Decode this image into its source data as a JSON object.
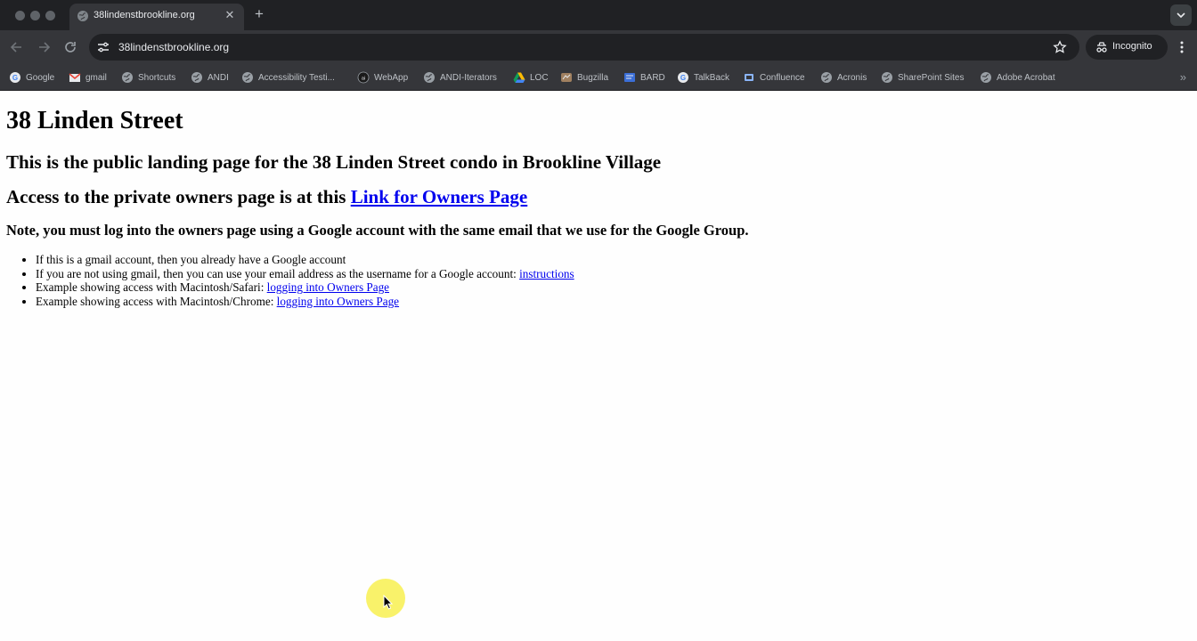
{
  "browser": {
    "tab": {
      "title": "38lindenstbrookline.org",
      "close_glyph": "✕"
    },
    "new_tab_glyph": "+",
    "url": "38lindenstbrookline.org",
    "incognito_label": "Incognito",
    "bookmarks": [
      {
        "label": "Google",
        "icon": "google-icon"
      },
      {
        "label": "gmail",
        "icon": "gmail-icon"
      },
      {
        "label": "Shortcuts",
        "icon": "globe-icon"
      },
      {
        "label": "ANDI",
        "icon": "globe-icon"
      },
      {
        "label": "Accessibility Testi...",
        "icon": "globe-icon"
      },
      {
        "label": "WebApp",
        "icon": "webapp-icon"
      },
      {
        "label": "ANDI-Iterators",
        "icon": "globe-icon"
      },
      {
        "label": "LOC",
        "icon": "drive-icon"
      },
      {
        "label": "Bugzilla",
        "icon": "bugzilla-icon"
      },
      {
        "label": "BARD",
        "icon": "bard-icon"
      },
      {
        "label": "TalkBack",
        "icon": "google-icon"
      },
      {
        "label": "Confluence",
        "icon": "confluence-icon"
      },
      {
        "label": "Acronis",
        "icon": "globe-icon"
      },
      {
        "label": "SharePoint Sites",
        "icon": "globe-icon"
      },
      {
        "label": "Adobe Acrobat",
        "icon": "globe-icon"
      }
    ],
    "bookmarks_more_glyph": "»"
  },
  "page": {
    "title": "38 Linden Street",
    "subtitle": "This is the public landing page for the 38 Linden Street condo in Brookline Village",
    "access_text": "Access to the private owners page is at this ",
    "access_link": "Link for Owners Page",
    "note": "Note, you must log into the owners page using a Google account with the same email that we use for the Google Group.",
    "bullets": [
      {
        "text": "If this is a gmail account, then you already have a Google account",
        "link": ""
      },
      {
        "text": "If you are not using gmail, then you can use your email address as the username for a Google account: ",
        "link": "instructions"
      },
      {
        "text": "Example showing access with Macintosh/Safari: ",
        "link": "logging into Owners Page"
      },
      {
        "text": "Example showing access with Macintosh/Chrome: ",
        "link": "logging into Owners Page"
      }
    ]
  },
  "colors": {
    "chrome_dark": "#202124",
    "chrome_toolbar": "#35363a",
    "link": "#0000ee",
    "cursor_highlight": "#f8f050"
  }
}
